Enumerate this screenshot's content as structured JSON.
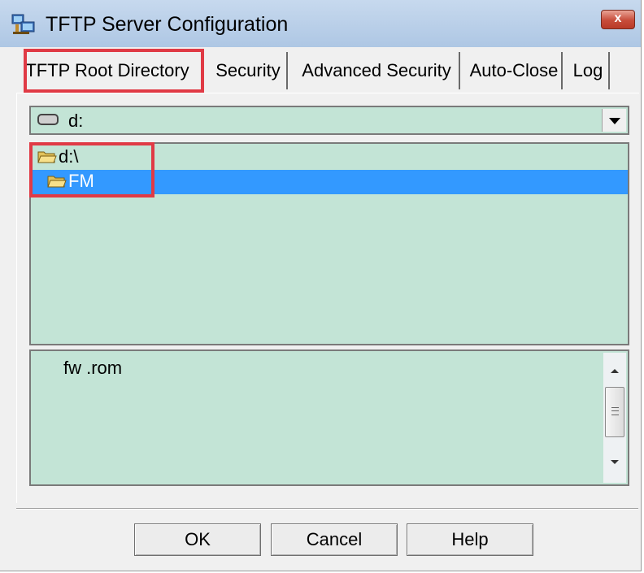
{
  "window": {
    "title": "TFTP Server Configuration",
    "close_label": "x"
  },
  "tabs": [
    {
      "label": "TFTP Root Directory",
      "active": true
    },
    {
      "label": "Security"
    },
    {
      "label": "Advanced Security"
    },
    {
      "label": "Auto-Close"
    },
    {
      "label": "Log"
    }
  ],
  "drive_selector": {
    "value": "d:"
  },
  "folder_tree": [
    {
      "label": "d:\\",
      "selected": false
    },
    {
      "label": "FM",
      "selected": true
    }
  ],
  "file_list": [
    "fw .rom"
  ],
  "buttons": {
    "ok": "OK",
    "cancel": "Cancel",
    "help": "Help"
  },
  "colors": {
    "list_background": "#c3e4d6",
    "selection": "#3399ff",
    "highlight_box": "#e03a45",
    "window_background": "#f0f0f0"
  }
}
